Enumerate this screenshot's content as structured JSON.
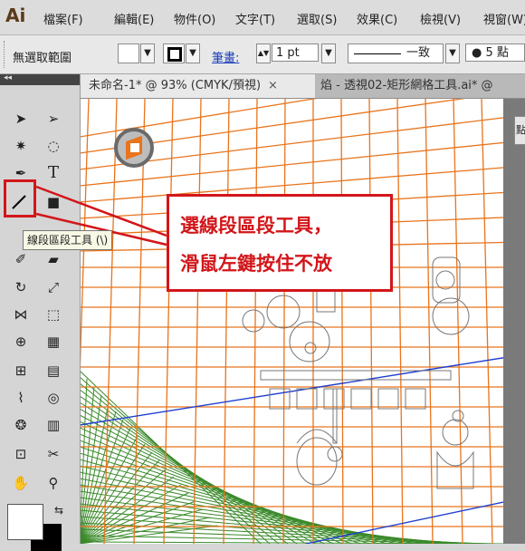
{
  "app": {
    "logo": "Ai"
  },
  "menu": [
    "檔案(F)",
    "編輯(E)",
    "物件(O)",
    "文字(T)",
    "選取(S)",
    "效果(C)",
    "檢視(V)",
    "視窗(W)"
  ],
  "control": {
    "selection_label": "無選取範圍",
    "stroke_label": "筆畫:",
    "stroke_value": "1 pt",
    "profile_value": "一致",
    "brush_value": "5 點"
  },
  "tabs": [
    {
      "label": "未命名-1* @ 93% (CMYK/預視)",
      "close": "×"
    },
    {
      "label": "焰 - 透視02-矩形網格工具.ai* @",
      "close": ""
    }
  ],
  "tooltip": "線段區段工具 (\\)",
  "callout": {
    "line1": "選線段區段工具，",
    "line2": "滑鼠左鍵按住不放"
  },
  "colors": {
    "accent": "#d2161a",
    "grid_orange": "#e8741c",
    "grid_blue": "#1e3fd0",
    "grid_green": "#3a8a2a"
  }
}
